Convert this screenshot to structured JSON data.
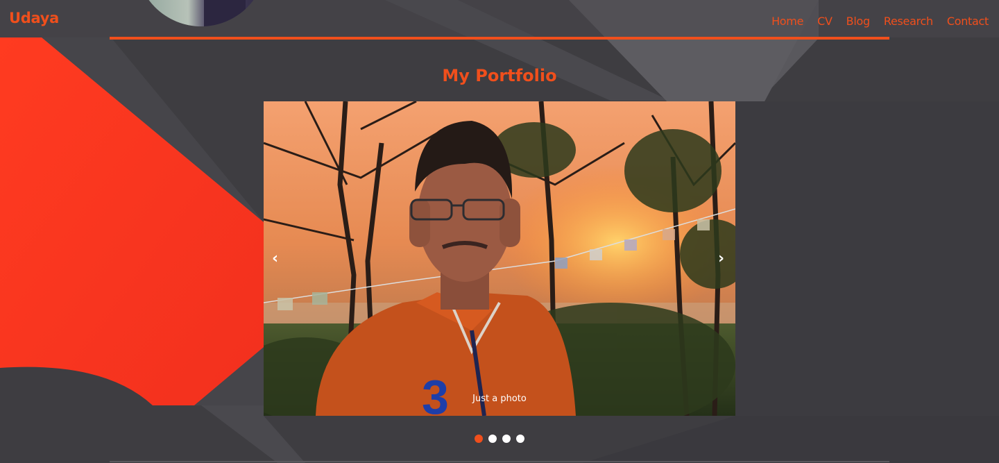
{
  "header": {
    "brand": "Udaya",
    "nav": [
      "Home",
      "CV",
      "Blog",
      "Research",
      "Contact"
    ]
  },
  "main": {
    "title": "My Portfolio",
    "carousel": {
      "caption": "Just a photo",
      "prev_label": "‹",
      "next_label": "›",
      "slide_count": 4,
      "active_index": 0
    }
  },
  "colors": {
    "accent": "#f04f1c",
    "background": "#3e3d41",
    "red_shape": "#ff3a1f"
  }
}
